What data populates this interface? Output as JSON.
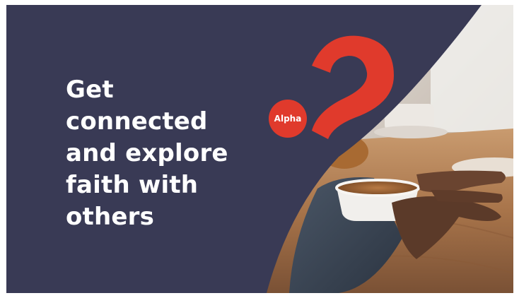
{
  "banner": {
    "headline_lines": [
      "Get",
      "connected",
      "and explore",
      "faith with",
      "others"
    ],
    "logo_label": "Alpha"
  },
  "colors": {
    "navy_background": "#393a55",
    "brand_red": "#e03a2c",
    "headline_text": "#ffffff"
  },
  "icons": {
    "logo": "alpha-question-mark-logo"
  }
}
